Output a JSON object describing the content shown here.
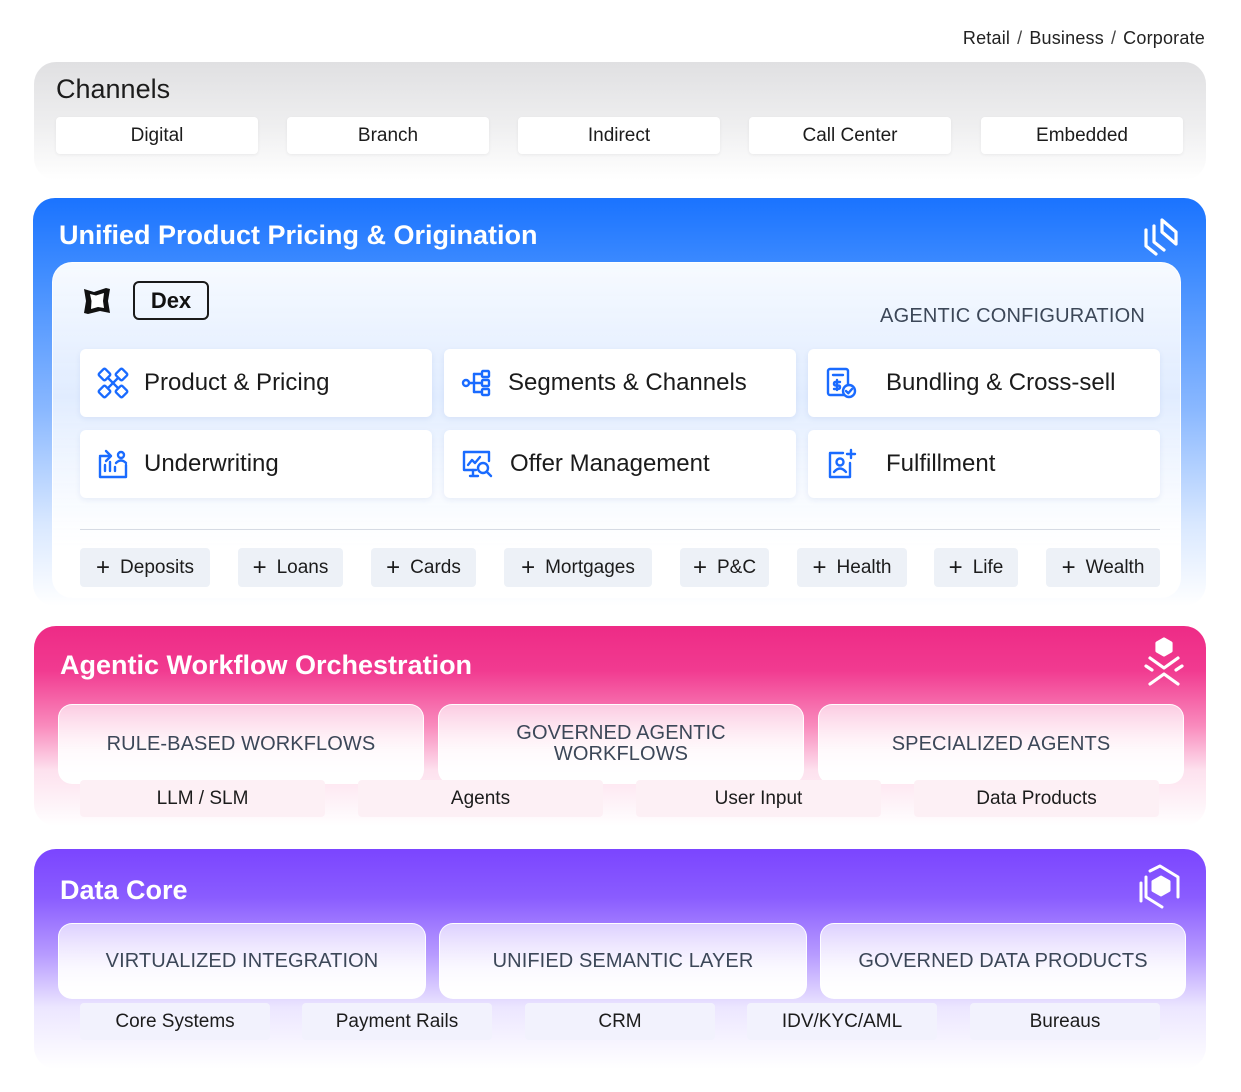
{
  "breadcrumb": [
    "Retail",
    "Business",
    "Corporate"
  ],
  "channels": {
    "title": "Channels",
    "items": [
      "Digital",
      "Branch",
      "Indirect",
      "Call Center",
      "Embedded"
    ]
  },
  "unified": {
    "title": "Unified Product Pricing & Origination",
    "badge": "Dex",
    "section_label": "AGENTIC CONFIGURATION",
    "cards": [
      {
        "label": "Product & Pricing",
        "icon": "product-pricing-icon"
      },
      {
        "label": "Segments & Channels",
        "icon": "segments-channels-icon"
      },
      {
        "label": "Bundling & Cross-sell",
        "icon": "bundling-icon"
      },
      {
        "label": "Underwriting",
        "icon": "underwriting-icon"
      },
      {
        "label": "Offer Management",
        "icon": "offer-management-icon"
      },
      {
        "label": "Fulfillment",
        "icon": "fulfillment-icon"
      }
    ],
    "products": [
      "Deposits",
      "Loans",
      "Cards",
      "Mortgages",
      "P&C",
      "Health",
      "Life",
      "Wealth"
    ]
  },
  "agentic": {
    "title": "Agentic Workflow Orchestration",
    "sections": [
      "RULE-BASED WORKFLOWS",
      "GOVERNED AGENTIC WORKFLOWS",
      "SPECIALIZED AGENTS"
    ],
    "items": [
      "LLM / SLM",
      "Agents",
      "User Input",
      "Data Products"
    ]
  },
  "datacore": {
    "title": "Data Core",
    "sections": [
      "VIRTUALIZED INTEGRATION",
      "UNIFIED SEMANTIC LAYER",
      "GOVERNED DATA PRODUCTS"
    ],
    "items": [
      "Core Systems",
      "Payment Rails",
      "CRM",
      "IDV/KYC/AML",
      "Bureaus"
    ]
  },
  "colors": {
    "unified_blue": "#1a73ff",
    "agentic_pink": "#ee2b86",
    "datacore_purple": "#7b45ff",
    "icon_blue": "#1a6bff"
  }
}
